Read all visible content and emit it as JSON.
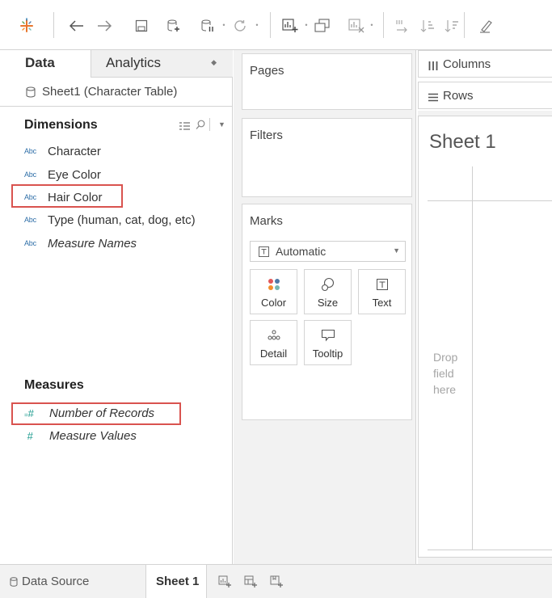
{
  "data_pane": {
    "tab_data": "Data",
    "tab_analytics": "Analytics",
    "datasource": "Sheet1 (Character Table)",
    "dimensions_title": "Dimensions",
    "dimensions": [
      {
        "type": "Abc",
        "label": "Character",
        "italic": false
      },
      {
        "type": "Abc",
        "label": "Eye Color",
        "italic": false
      },
      {
        "type": "Abc",
        "label": "Hair Color",
        "italic": false,
        "highlighted": true
      },
      {
        "type": "Abc",
        "label": "Type (human, cat, dog, etc)",
        "italic": false
      },
      {
        "type": "Abc",
        "label": "Measure Names",
        "italic": true
      }
    ],
    "measures_title": "Measures",
    "measures": [
      {
        "type": "#",
        "label": "Number of Records",
        "italic": true,
        "highlighted": true
      },
      {
        "type": "#",
        "label": "Measure Values",
        "italic": true
      }
    ]
  },
  "cards": {
    "pages": "Pages",
    "filters": "Filters",
    "marks": "Marks",
    "mark_type": "Automatic",
    "mark_buttons": {
      "color": "Color",
      "size": "Size",
      "text": "Text",
      "detail": "Detail",
      "tooltip": "Tooltip"
    }
  },
  "shelves": {
    "columns": "Columns",
    "rows": "Rows"
  },
  "view": {
    "sheet_title": "Sheet 1",
    "drop_hint": [
      "Drop",
      "field",
      "here"
    ]
  },
  "bottom": {
    "data_source": "Data Source",
    "sheet_tab": "Sheet 1"
  },
  "colors": {
    "highlight": "#d9534f",
    "dimension_blue": "#2f6fa8",
    "measure_green": "#1d9b8e",
    "panel_gray": "#f2f2f2"
  },
  "icons": {
    "toolbar": [
      "tableau-logo-icon",
      "back-arrow-icon",
      "forward-arrow-icon",
      "save-icon",
      "new-datasource-icon",
      "pause-updates-icon",
      "refresh-icon",
      "new-worksheet-icon",
      "duplicate-icon",
      "clear-sheet-icon",
      "swap-icon",
      "sort-ascending-icon",
      "sort-descending-icon",
      "highlight-icon"
    ]
  }
}
